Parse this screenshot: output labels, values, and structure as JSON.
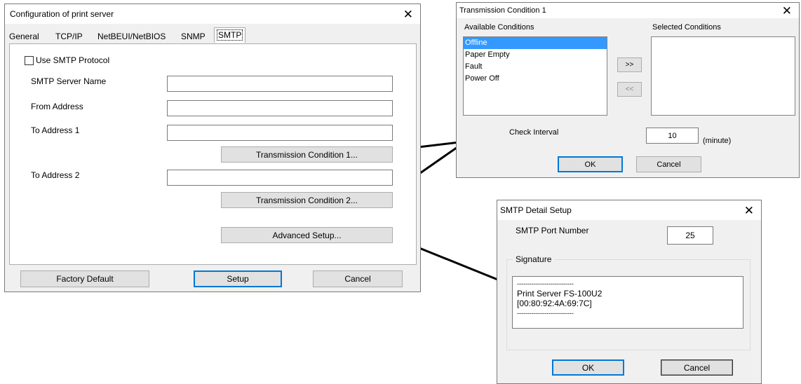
{
  "config": {
    "title": "Configuration of print server",
    "tabs": [
      "General",
      "TCP/IP",
      "NetBEUI/NetBIOS",
      "SNMP",
      "SMTP"
    ],
    "use_smtp_label": "Use SMTP Protocol",
    "use_smtp_checked": false,
    "smtp_server_label": "SMTP Server Name",
    "smtp_server_value": "",
    "from_address_label": "From Address",
    "from_address_value": "",
    "to_address1_label": "To Address 1",
    "to_address1_value": "",
    "transmission1_button": "Transmission Condition 1...",
    "to_address2_label": "To Address 2",
    "to_address2_value": "",
    "transmission2_button": "Transmission Condition 2...",
    "advanced_button": "Advanced Setup...",
    "factory_default_button": "Factory Default",
    "setup_button": "Setup",
    "cancel_button": "Cancel"
  },
  "transmission": {
    "title": "Transmission Condition 1",
    "available_label": "Available Conditions",
    "selected_label": "Selected Conditions",
    "available_items": [
      "Offline",
      "Paper Empty",
      "Fault",
      "Power Off"
    ],
    "selected_index": 0,
    "selected_items": [],
    "add_button": ">>",
    "remove_button": "<<",
    "check_interval_label": "Check Interval",
    "check_interval_value": "10",
    "unit_label": "(minute)",
    "ok_button": "OK",
    "cancel_button": "Cancel"
  },
  "smtp_detail": {
    "title": "SMTP Detail Setup",
    "port_label": "SMTP Port Number",
    "port_value": "25",
    "signature_label": "Signature",
    "signature_lines": [
      "---------------------------",
      "Print Server FS-100U2",
      "[00:80:92:4A:69:7C]",
      "---------------------------"
    ],
    "ok_button": "OK",
    "cancel_button": "Cancel"
  },
  "icons": {
    "close": "close-icon",
    "checkbox": "checkbox-icon"
  },
  "colors": {
    "window_bg": "#f0f0f0",
    "selection": "#3399ff",
    "default_button_border": "#0078d7"
  }
}
